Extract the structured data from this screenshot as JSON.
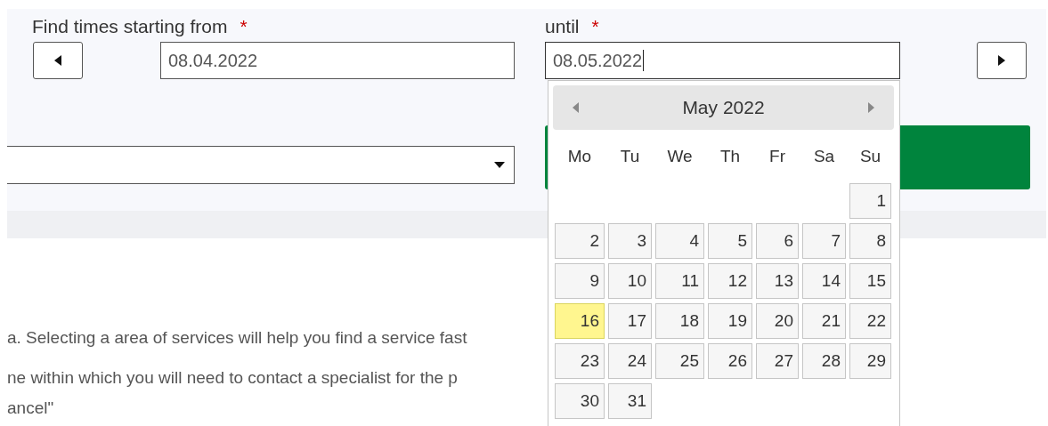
{
  "from_field": {
    "label": "Find times starting from",
    "required_mark": "*",
    "value": "08.04.2022"
  },
  "until_field": {
    "label": "until",
    "required_mark": "*",
    "value": "08.05.2022",
    "focused": true
  },
  "calendar": {
    "title": "May 2022",
    "weekdays": [
      "Mo",
      "Tu",
      "We",
      "Th",
      "Fr",
      "Sa",
      "Su"
    ],
    "days": [
      {
        "kind": "blank"
      },
      {
        "kind": "blank"
      },
      {
        "kind": "blank"
      },
      {
        "kind": "blank"
      },
      {
        "kind": "blank"
      },
      {
        "kind": "blank"
      },
      {
        "kind": "day",
        "label": "1",
        "today": false
      },
      {
        "kind": "day",
        "label": "2",
        "today": false
      },
      {
        "kind": "day",
        "label": "3",
        "today": false
      },
      {
        "kind": "day",
        "label": "4",
        "today": false
      },
      {
        "kind": "day",
        "label": "5",
        "today": false
      },
      {
        "kind": "day",
        "label": "6",
        "today": false
      },
      {
        "kind": "day",
        "label": "7",
        "today": false
      },
      {
        "kind": "day",
        "label": "8",
        "today": false
      },
      {
        "kind": "day",
        "label": "9",
        "today": false
      },
      {
        "kind": "day",
        "label": "10",
        "today": false
      },
      {
        "kind": "day",
        "label": "11",
        "today": false
      },
      {
        "kind": "day",
        "label": "12",
        "today": false
      },
      {
        "kind": "day",
        "label": "13",
        "today": false
      },
      {
        "kind": "day",
        "label": "14",
        "today": false
      },
      {
        "kind": "day",
        "label": "15",
        "today": false
      },
      {
        "kind": "day",
        "label": "16",
        "today": true
      },
      {
        "kind": "day",
        "label": "17",
        "today": false
      },
      {
        "kind": "day",
        "label": "18",
        "today": false
      },
      {
        "kind": "day",
        "label": "19",
        "today": false
      },
      {
        "kind": "day",
        "label": "20",
        "today": false
      },
      {
        "kind": "day",
        "label": "21",
        "today": false
      },
      {
        "kind": "day",
        "label": "22",
        "today": false
      },
      {
        "kind": "day",
        "label": "23",
        "today": false
      },
      {
        "kind": "day",
        "label": "24",
        "today": false
      },
      {
        "kind": "day",
        "label": "25",
        "today": false
      },
      {
        "kind": "day",
        "label": "26",
        "today": false
      },
      {
        "kind": "day",
        "label": "27",
        "today": false
      },
      {
        "kind": "day",
        "label": "28",
        "today": false
      },
      {
        "kind": "day",
        "label": "29",
        "today": false
      },
      {
        "kind": "day",
        "label": "30",
        "today": false
      },
      {
        "kind": "day",
        "label": "31",
        "today": false
      }
    ]
  },
  "paragraph_lines": [
    "a. Selecting a area of services will help you find a service fast",
    "ne within which you will need to contact a specialist for the p"
  ],
  "note_line": "ancel\""
}
